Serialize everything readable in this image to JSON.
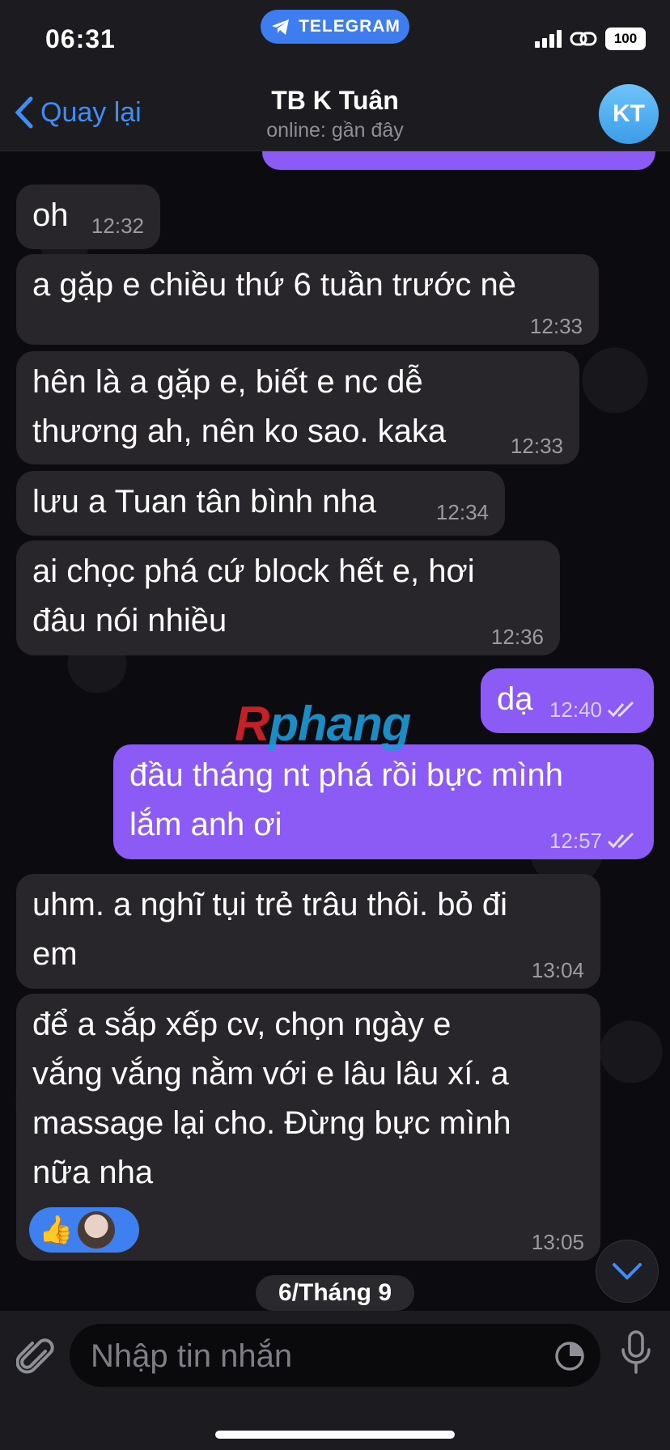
{
  "status_bar": {
    "time": "06:31",
    "app_pill": "TELEGRAM",
    "battery": "100"
  },
  "header": {
    "back_label": "Quay lại",
    "title": "TB K Tuân",
    "subtitle": "online: gần đây",
    "avatar_initials": "KT"
  },
  "messages": [
    {
      "text": "oh",
      "time": "12:32",
      "direction": "in"
    },
    {
      "text": "a gặp e chiều thứ 6 tuần trước nè",
      "time": "12:33",
      "direction": "in"
    },
    {
      "text": "hên là a gặp e, biết e nc dễ\nthương ah, nên ko sao. kaka",
      "time": "12:33",
      "direction": "in"
    },
    {
      "text": "lưu a Tuan tân bình nha",
      "time": "12:34",
      "direction": "in"
    },
    {
      "text": "ai chọc phá cứ block hết e, hơi\nđâu nói nhiều",
      "time": "12:36",
      "direction": "in"
    },
    {
      "text": "dạ",
      "time": "12:40",
      "direction": "out"
    },
    {
      "text": "đầu tháng nt phá rồi bực mình\nlắm anh ơi",
      "time": "12:57",
      "direction": "out"
    },
    {
      "text": "uhm. a nghĩ tụi trẻ trâu thôi. bỏ đi\nem",
      "time": "13:04",
      "direction": "in"
    },
    {
      "text": "để a sắp xếp cv, chọn ngày e\nvắng vắng nằm với e lâu lâu xí. a\nmassage lại cho. Đừng bực mình\nnữa nha",
      "time": "13:05",
      "direction": "in",
      "reaction": "👍"
    }
  ],
  "watermark": {
    "prefix": "R",
    "rest": "phang"
  },
  "date_separator": "6/Tháng 9",
  "input": {
    "placeholder": "Nhập tin nhắn"
  },
  "colors": {
    "accent": "#3e8ef7",
    "outgoing_bubble": "#8c5af5",
    "incoming_bubble": "#28262b"
  }
}
